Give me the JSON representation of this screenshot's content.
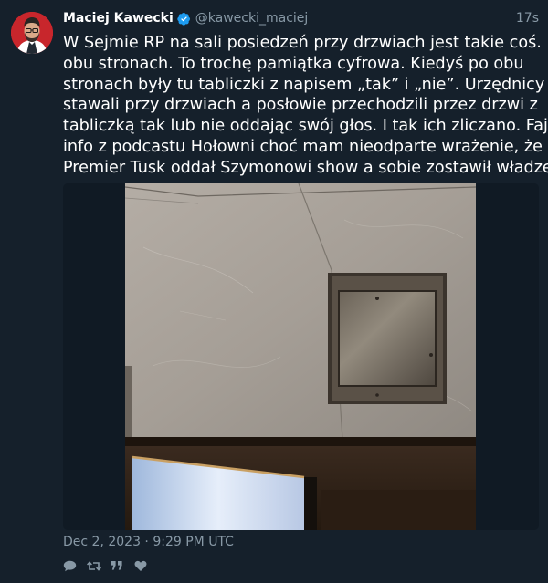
{
  "author": {
    "name": "Maciej Kawecki",
    "handle": "@kawecki_maciej"
  },
  "timestamp_relative": "17s",
  "tweet": {
    "lines": [
      "W Sejmie RP na sali posiedzeń przy drzwiach jest takie coś. Po",
      "obu stronach. To trochę pamiątka cyfrowa. Kiedyś po obu",
      "stronach były tu tabliczki z napisem „tak” i „nie”. Urzędnicy",
      "stawali przy drzwiach a posłowie przechodzili przez drzwi z",
      "tabliczką tak lub nie oddając swój głos. I tak ich zliczano. Fajne",
      "info z podcastu Hołowni choć mam nieodparte wrażenie, że",
      "Premier Tusk oddał Szymonowi show a sobie zostawił władzę."
    ]
  },
  "date_full": "Dec 2, 2023 · 9:29 PM UTC",
  "icons": {
    "verified": "verified-badge-icon",
    "reply": "reply-icon",
    "retweet": "retweet-icon",
    "quote": "quote-icon",
    "like": "heart-icon"
  },
  "colors": {
    "background": "#15202b",
    "muted": "#8899a6",
    "verified": "#1d9bf0"
  }
}
